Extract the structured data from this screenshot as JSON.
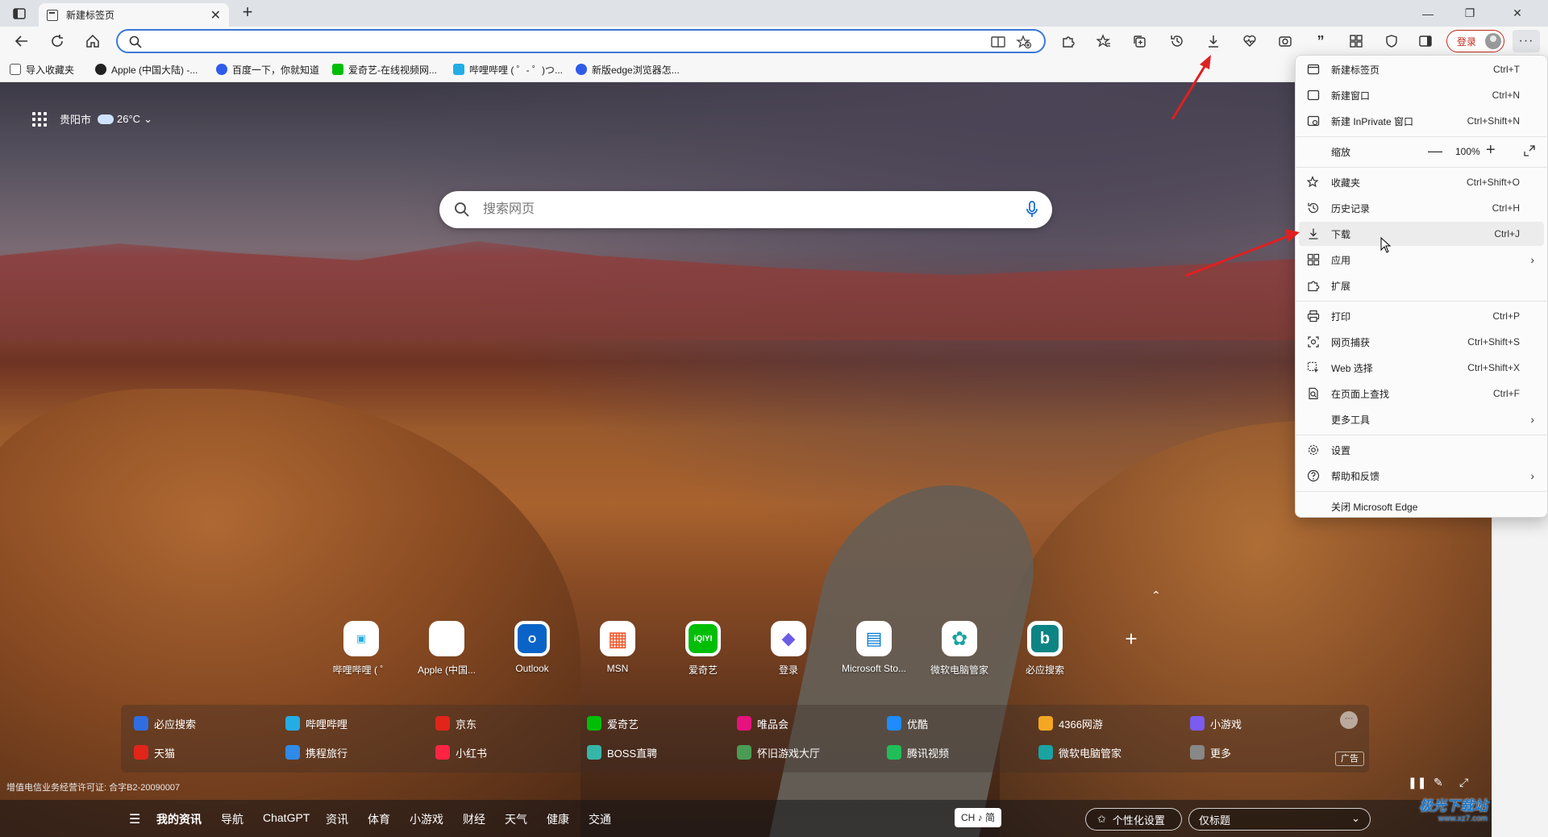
{
  "tab": {
    "title": "新建标签页"
  },
  "address_bar": {
    "value": "",
    "placeholder": ""
  },
  "toolbar": {
    "login_label": "登录"
  },
  "favorites": [
    {
      "label": "导入收藏夹",
      "icon": "import-icon",
      "color": "#555555"
    },
    {
      "label": "Apple (中国大陆) -...",
      "icon": "apple-icon",
      "color": "#222222"
    },
    {
      "label": "百度一下，你就知道",
      "icon": "baidu-icon",
      "color": "#2f5bea"
    },
    {
      "label": "爱奇艺-在线视频网...",
      "icon": "iqiyi-icon",
      "color": "#00be06"
    },
    {
      "label": "哔哩哔哩 ( ゜- ゜)つ...",
      "icon": "bilibili-icon",
      "color": "#23ade5"
    },
    {
      "label": "新版edge浏览器怎...",
      "icon": "paw-icon",
      "color": "#2f5bea"
    }
  ],
  "weather": {
    "city": "贵阳市",
    "temp": "26°C"
  },
  "ntp_search": {
    "placeholder": "搜索网页"
  },
  "tiles": [
    {
      "label": "哔哩哔哩 ( ゜",
      "glyph": "▣",
      "color": "#23ade5"
    },
    {
      "label": "Apple (中国...",
      "glyph": "",
      "color": "#111111"
    },
    {
      "label": "Outlook",
      "glyph": "O",
      "color": "#0a64c8"
    },
    {
      "label": "MSN",
      "glyph": "▦",
      "color": "#f25022"
    },
    {
      "label": "爱奇艺",
      "glyph": "iQIYI",
      "color": "#00be06"
    },
    {
      "label": "登录",
      "glyph": "◆",
      "color": "#6b5ce7"
    },
    {
      "label": "Microsoft Sto...",
      "glyph": "▤",
      "color": "#0078d4"
    },
    {
      "label": "微软电脑管家",
      "glyph": "✿",
      "color": "#1aa3a3"
    },
    {
      "label": "必应搜索",
      "glyph": "b",
      "color": "#0c8484"
    }
  ],
  "site_links": {
    "row1": [
      {
        "label": "必应搜索",
        "color": "#2f6de1"
      },
      {
        "label": "哔哩哔哩",
        "color": "#23ade5"
      },
      {
        "label": "京东",
        "color": "#e1251b"
      },
      {
        "label": "爱奇艺",
        "color": "#00be06"
      },
      {
        "label": "唯品会",
        "color": "#e6127d"
      },
      {
        "label": "优酷",
        "color": "#1e8bff"
      },
      {
        "label": "4366网游",
        "color": "#f5a623"
      },
      {
        "label": "小游戏",
        "color": "#7b5cf0"
      }
    ],
    "row2": [
      {
        "label": "天猫",
        "color": "#e1251b"
      },
      {
        "label": "携程旅行",
        "color": "#2f8ae8"
      },
      {
        "label": "小红书",
        "color": "#ff2442"
      },
      {
        "label": "BOSS直聘",
        "color": "#36b6a8"
      },
      {
        "label": "怀旧游戏大厅",
        "color": "#4a9c54"
      },
      {
        "label": "腾讯视频",
        "color": "#1fbe58"
      },
      {
        "label": "微软电脑管家",
        "color": "#1aa3a3"
      },
      {
        "label": "更多",
        "color": "#888888"
      }
    ],
    "ad_label": "广告"
  },
  "license_text": "增值电信业务经营许可证: 合字B2-20090007",
  "feed_tabs": [
    "我的资讯",
    "导航",
    "ChatGPT",
    "资讯",
    "体育",
    "小游戏",
    "财经",
    "天气",
    "健康",
    "交通"
  ],
  "ime_label": "CH ♪ 简",
  "personalize_label": "个性化设置",
  "view_select": "仅标题",
  "watermark": {
    "main": "极光下载站",
    "sub": "www.xz7.com"
  },
  "menu": {
    "items": [
      {
        "label": "新建标签页",
        "shortcut": "Ctrl+T",
        "icon": "new-tab-icon"
      },
      {
        "label": "新建窗口",
        "shortcut": "Ctrl+N",
        "icon": "new-window-icon"
      },
      {
        "label": "新建 InPrivate 窗口",
        "shortcut": "Ctrl+Shift+N",
        "icon": "inprivate-icon"
      },
      {
        "label": "缩放",
        "shortcut": "",
        "icon": ""
      },
      {
        "label": "收藏夹",
        "shortcut": "Ctrl+Shift+O",
        "icon": "favorites-icon"
      },
      {
        "label": "历史记录",
        "shortcut": "Ctrl+H",
        "icon": "history-icon"
      },
      {
        "label": "下载",
        "shortcut": "Ctrl+J",
        "icon": "download-icon"
      },
      {
        "label": "应用",
        "shortcut": "",
        "icon": "apps-icon"
      },
      {
        "label": "扩展",
        "shortcut": "",
        "icon": "extensions-icon"
      },
      {
        "label": "打印",
        "shortcut": "Ctrl+P",
        "icon": "print-icon"
      },
      {
        "label": "网页捕获",
        "shortcut": "Ctrl+Shift+S",
        "icon": "capture-icon"
      },
      {
        "label": "Web 选择",
        "shortcut": "Ctrl+Shift+X",
        "icon": "web-select-icon"
      },
      {
        "label": "在页面上查找",
        "shortcut": "Ctrl+F",
        "icon": "find-icon"
      },
      {
        "label": "更多工具",
        "shortcut": "",
        "icon": ""
      },
      {
        "label": "设置",
        "shortcut": "",
        "icon": "settings-icon"
      },
      {
        "label": "帮助和反馈",
        "shortcut": "",
        "icon": "help-icon"
      },
      {
        "label": "关闭 Microsoft Edge",
        "shortcut": "",
        "icon": ""
      }
    ],
    "zoom_value": "100%"
  }
}
